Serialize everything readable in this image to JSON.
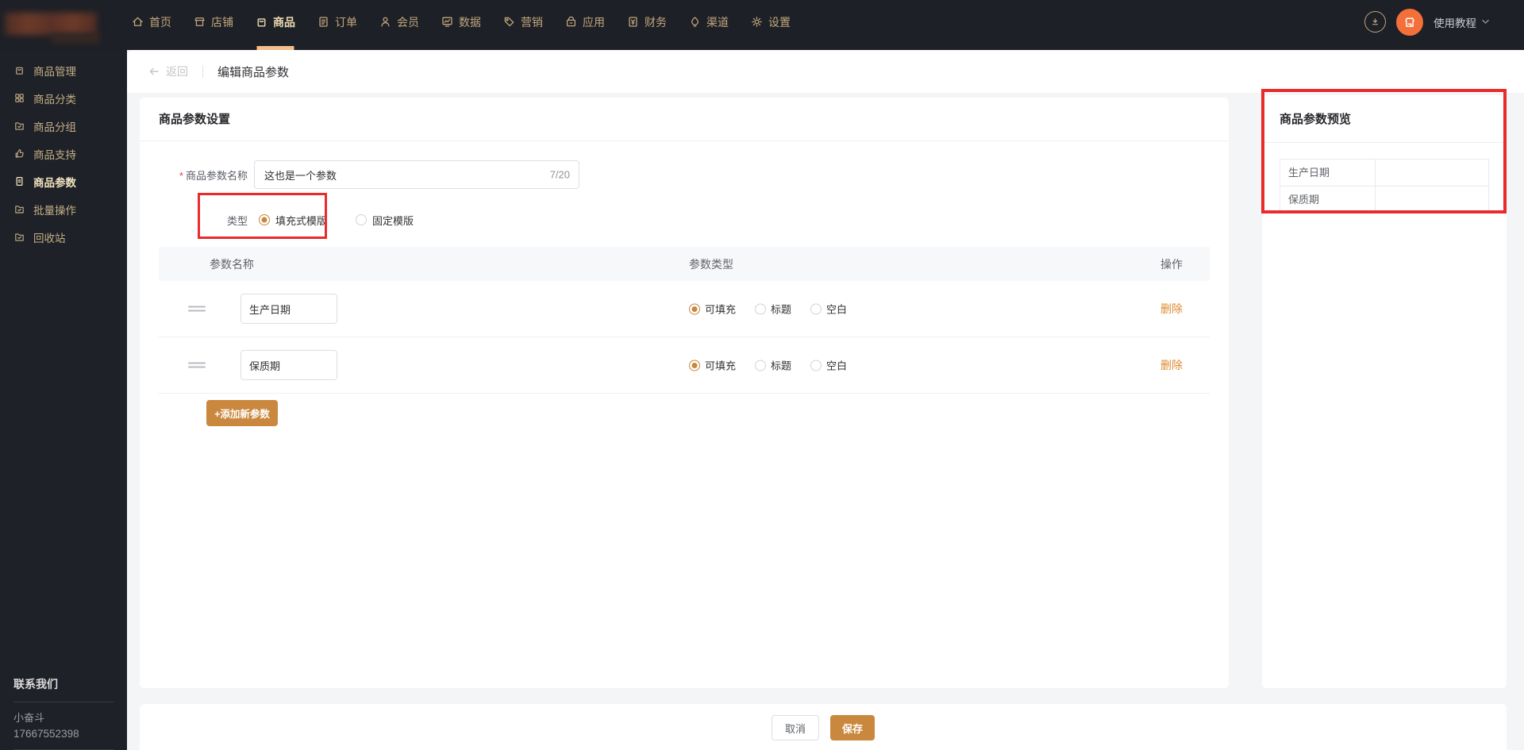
{
  "topnav": {
    "items": [
      {
        "label": "首页",
        "icon": "home-icon"
      },
      {
        "label": "店铺",
        "icon": "store-icon"
      },
      {
        "label": "商品",
        "icon": "goods-icon",
        "active": true
      },
      {
        "label": "订单",
        "icon": "order-icon"
      },
      {
        "label": "会员",
        "icon": "member-icon"
      },
      {
        "label": "数据",
        "icon": "data-icon"
      },
      {
        "label": "营销",
        "icon": "marketing-icon"
      },
      {
        "label": "应用",
        "icon": "app-icon"
      },
      {
        "label": "财务",
        "icon": "finance-icon"
      },
      {
        "label": "渠道",
        "icon": "channel-icon"
      },
      {
        "label": "设置",
        "icon": "settings-icon"
      }
    ],
    "tutorial_label": "使用教程"
  },
  "sidebar": {
    "items": [
      {
        "label": "商品管理",
        "icon": "goods-box-icon"
      },
      {
        "label": "商品分类",
        "icon": "grid-icon"
      },
      {
        "label": "商品分组",
        "icon": "folder-icon"
      },
      {
        "label": "商品支持",
        "icon": "thumbs-up-icon"
      },
      {
        "label": "商品参数",
        "icon": "document-icon",
        "active": true
      },
      {
        "label": "批量操作",
        "icon": "folder-icon"
      },
      {
        "label": "回收站",
        "icon": "folder-icon"
      }
    ],
    "contact": {
      "title": "联系我们",
      "name": "小奋斗",
      "phone": "17667552398"
    }
  },
  "breadcrumb": {
    "back_label": "返回",
    "title": "编辑商品参数"
  },
  "settings_card": {
    "title": "商品参数设置",
    "name_label": "商品参数名称",
    "name_value": "这也是一个参数",
    "name_counter": "7/20",
    "type_label": "类型",
    "type_options": [
      {
        "label": "填充式模版",
        "selected": true
      },
      {
        "label": "固定模版",
        "selected": false
      }
    ],
    "table": {
      "headers": {
        "name": "参数名称",
        "type": "参数类型",
        "op": "操作"
      },
      "type_choices": [
        "可填充",
        "标题",
        "空白"
      ],
      "rows": [
        {
          "name": "生产日期",
          "type": "可填充"
        },
        {
          "name": "保质期",
          "type": "可填充"
        }
      ],
      "delete_label": "删除"
    },
    "add_button_label": "+添加新参数"
  },
  "preview_card": {
    "title": "商品参数预览",
    "rows": [
      {
        "key": "生产日期",
        "value": ""
      },
      {
        "key": "保质期",
        "value": ""
      }
    ]
  },
  "footer_bar": {
    "cancel_label": "取消",
    "save_label": "保存"
  },
  "colors": {
    "accent": "#C9883E",
    "nav_gold": "#C2A67C",
    "active_underline": "#F2BE8B",
    "avatar_orange": "#F4703A",
    "delete_orange": "#DD8A2E",
    "annotation_red": "#EA2B2B",
    "dark_bg": "#1D2026"
  }
}
